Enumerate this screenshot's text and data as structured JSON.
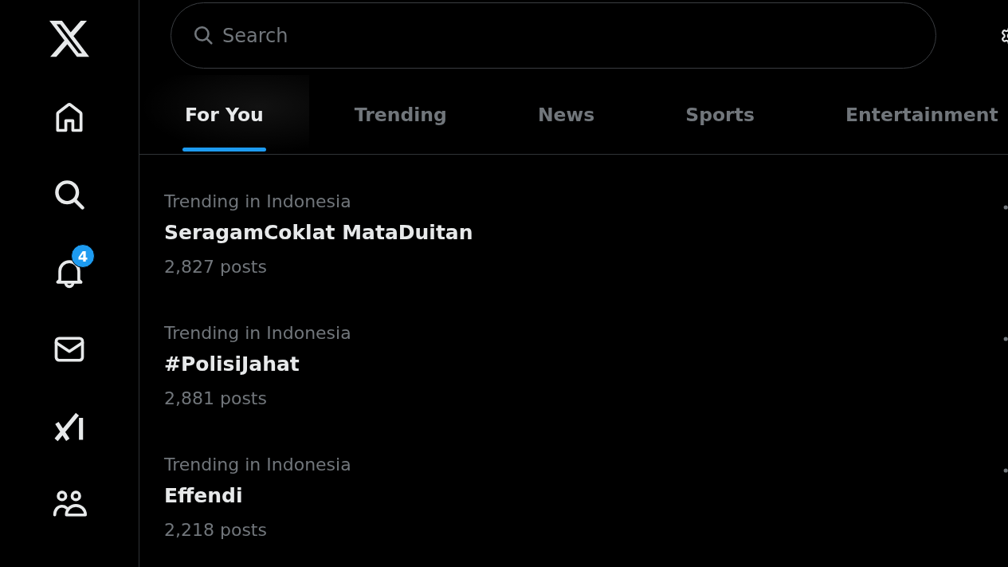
{
  "sidebar": {
    "notification_badge": "4"
  },
  "search": {
    "placeholder": "Search"
  },
  "tabs": [
    {
      "label": "For You",
      "selected": true
    },
    {
      "label": "Trending",
      "selected": false
    },
    {
      "label": "News",
      "selected": false
    },
    {
      "label": "Sports",
      "selected": false
    },
    {
      "label": "Entertainment",
      "selected": false
    }
  ],
  "trends": [
    {
      "context": "Trending in Indonesia",
      "title": "SeragamCoklat MataDuitan",
      "posts": "2,827 posts"
    },
    {
      "context": "Trending in Indonesia",
      "title": "#PolisiJahat",
      "posts": "2,881 posts"
    },
    {
      "context": "Trending in Indonesia",
      "title": "Effendi",
      "posts": "2,218 posts"
    }
  ]
}
